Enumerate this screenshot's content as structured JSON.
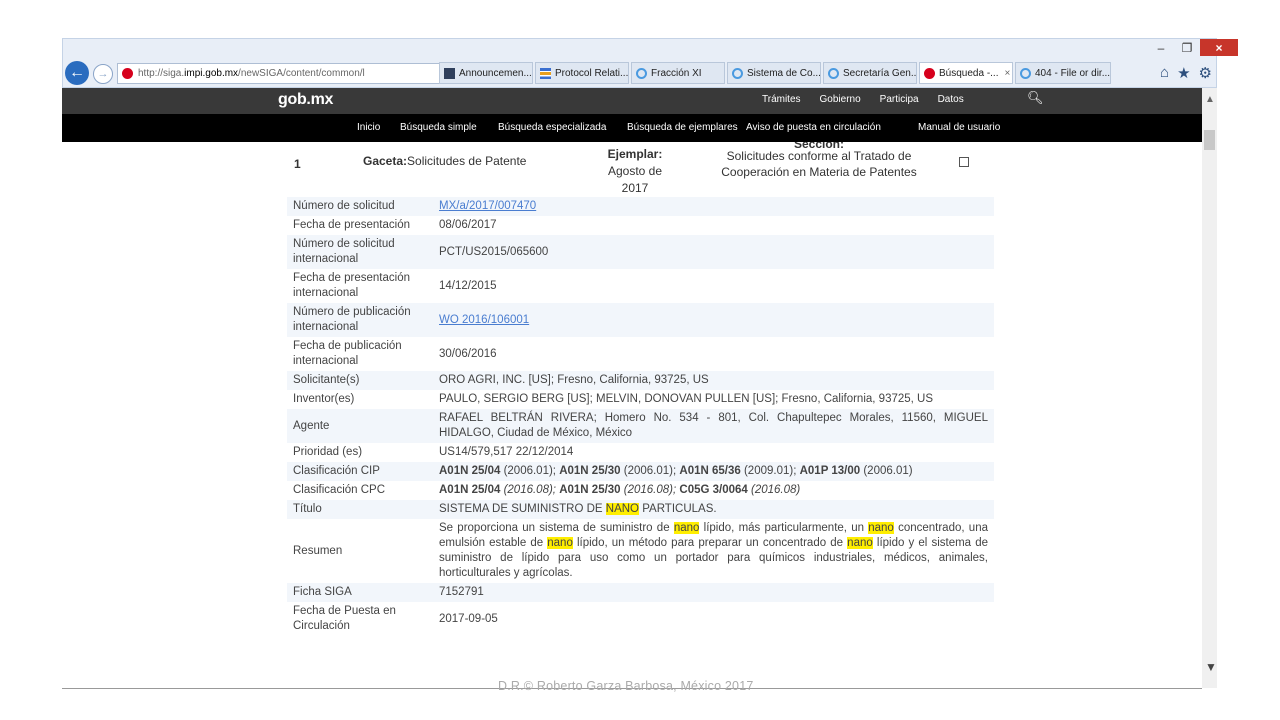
{
  "browser": {
    "url_prefix": "http://siga.",
    "url_domain": "impi.gob.mx",
    "url_path": "/newSIGA/content/common/l",
    "url_tools": "⌕ ▾ C",
    "tabs": [
      {
        "label": "Announcemen...",
        "icon": "news-icon",
        "active": false
      },
      {
        "label": "Protocol Relati...",
        "icon": "stack-icon",
        "active": false
      },
      {
        "label": "Fracción XI",
        "icon": "ie-icon",
        "active": false
      },
      {
        "label": "Sistema de Co...",
        "icon": "ie-icon",
        "active": false
      },
      {
        "label": "Secretaría Gen...",
        "icon": "ie-icon",
        "active": false
      },
      {
        "label": "Búsqueda -...",
        "icon": "red-dot-icon",
        "active": true
      },
      {
        "label": "404 - File or dir...",
        "icon": "ie-icon",
        "active": false
      }
    ],
    "close_glyph": "×",
    "right_icons": [
      "home-icon",
      "star-icon",
      "gear-icon"
    ]
  },
  "header": {
    "logo": "gob.mx",
    "links": [
      "Trámites",
      "Gobierno",
      "Participa",
      "Datos"
    ]
  },
  "subnav": [
    "Inicio",
    "Búsqueda simple",
    "Búsqueda especializada",
    "Búsqueda de ejemplares",
    "Aviso de puesta en circulación",
    "Manual de usuario"
  ],
  "record": {
    "number": "1",
    "gazette_label": "Gaceta:",
    "gazette_value": "Solicitudes de Patente",
    "copy_label": "Ejemplar:",
    "copy_value": "Agosto de 2017",
    "section_label": "Sección:",
    "section_value": "Solicitudes conforme al Tratado de Cooperación en Materia de Patentes"
  },
  "details": {
    "numero_solicitud": {
      "k": "Número de solicitud",
      "v": "MX/a/2017/007470"
    },
    "fecha_presentacion": {
      "k": "Fecha de presentación",
      "v": "08/06/2017"
    },
    "num_sol_int": {
      "k": "Número de solicitud internacional",
      "v": "PCT/US2015/065600"
    },
    "fecha_pres_int": {
      "k": "Fecha de presentación internacional",
      "v": "14/12/2015"
    },
    "num_pub_int": {
      "k": "Número de publicación internacional",
      "v": "WO 2016/106001"
    },
    "fecha_pub_int": {
      "k": "Fecha de publicación internacional",
      "v": "30/06/2016"
    },
    "solicitante": {
      "k": "Solicitante(s)",
      "v": "ORO AGRI, INC. [US]; Fresno, California, 93725, US"
    },
    "inventor": {
      "k": "Inventor(es)",
      "v": "PAULO, SERGIO BERG [US]; MELVIN, DONOVAN PULLEN [US]; Fresno, California, 93725, US"
    },
    "agente": {
      "k": "Agente",
      "v": "RAFAEL BELTRÁN RIVERA; Homero No. 534 - 801, Col. Chapultepec Morales, 11560, MIGUEL HIDALGO, Ciudad de México, México"
    },
    "prioridad": {
      "k": "Prioridad (es)",
      "v": "US14/579,517 22/12/2014"
    },
    "cip": {
      "k": "Clasificación CIP",
      "items": [
        {
          "code": "A01N 25/04",
          "ver": " (2006.01); "
        },
        {
          "code": "A01N 25/30",
          "ver": " (2006.01); "
        },
        {
          "code": "A01N 65/36",
          "ver": " (2009.01); "
        },
        {
          "code": "A01P 13/00",
          "ver": " (2006.01)"
        }
      ]
    },
    "cpc": {
      "k": "Clasificación CPC",
      "items": [
        {
          "code": "A01N 25/04",
          "ver": " (2016.08); "
        },
        {
          "code": "A01N 25/30",
          "ver": " (2016.08); "
        },
        {
          "code": "C05G 3/0064",
          "ver": " (2016.08)"
        }
      ]
    },
    "titulo": {
      "k": "Título",
      "parts": [
        "SISTEMA DE SUMINISTRO DE ",
        "NANO",
        " PARTICULAS."
      ]
    },
    "resumen": {
      "k": "Resumen",
      "parts": [
        "Se proporciona un sistema de suministro de ",
        "nano",
        " lípido, más particularmente, un ",
        "nano",
        " concentrado, una emulsión estable de ",
        "nano",
        " lípido, un método para preparar un concentrado de ",
        "nano",
        " lípido y el sistema de suministro de lípido para uso como un portador para químicos industriales, médicos, animales, horticulturales y agrícolas."
      ]
    },
    "ficha": {
      "k": "Ficha SIGA",
      "v": "7152791"
    },
    "fecha_puesta": {
      "k": "Fecha de Puesta en Circulación",
      "v": "2017-09-05"
    }
  },
  "footer": "D.R.© Roberto Garza Barbosa, México 2017"
}
